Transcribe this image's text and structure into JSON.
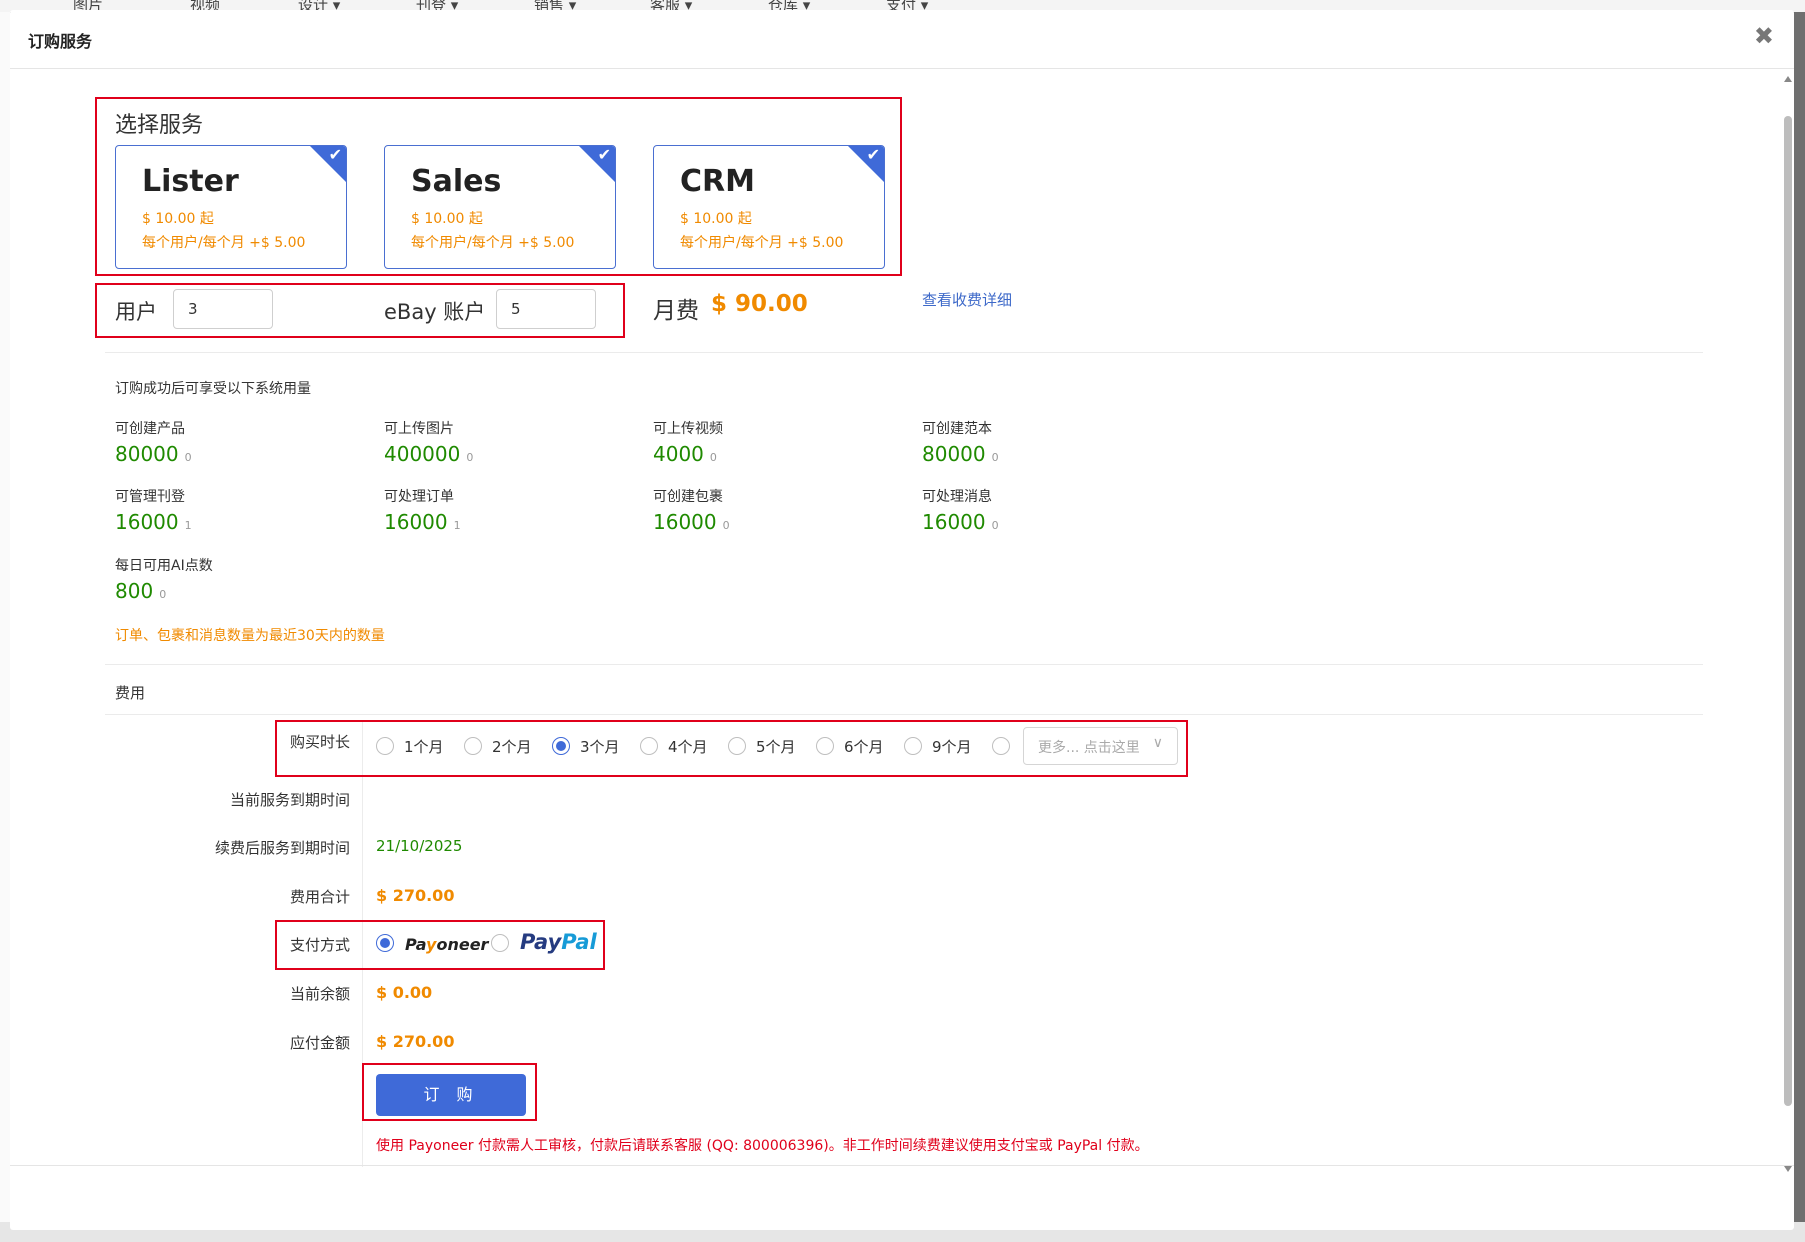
{
  "background": {
    "nav_items": [
      "图片",
      "视频",
      "设计 ▾",
      "刊登 ▾",
      "销售 ▾",
      "客服 ▾",
      "仓库 ▾",
      "支付 ▾"
    ]
  },
  "modal": {
    "title": "订购服务",
    "close_icon": "close-icon"
  },
  "services": {
    "heading": "选择服务",
    "items": [
      {
        "name": "Lister",
        "price": "$ 10.00 起",
        "per_user": "每个用户/每个月 +$ 5.00",
        "selected": true
      },
      {
        "name": "Sales",
        "price": "$ 10.00 起",
        "per_user": "每个用户/每个月 +$ 5.00",
        "selected": true
      },
      {
        "name": "CRM",
        "price": "$ 10.00 起",
        "per_user": "每个用户/每个月 +$ 5.00",
        "selected": true
      }
    ]
  },
  "users": {
    "label": "用户",
    "value": "3"
  },
  "ebay_accounts": {
    "label": "eBay 账户",
    "value": "5"
  },
  "monthly_fee": {
    "label": "月费",
    "amount": "$ 90.00",
    "detail_link": "查看收费详细"
  },
  "quota": {
    "intro": "订购成功后可享受以下系统用量",
    "items": [
      {
        "label": "可创建产品",
        "value": "80000",
        "used": "0"
      },
      {
        "label": "可上传图片",
        "value": "400000",
        "used": "0"
      },
      {
        "label": "可上传视频",
        "value": "4000",
        "used": "0"
      },
      {
        "label": "可创建范本",
        "value": "80000",
        "used": "0"
      },
      {
        "label": "可管理刊登",
        "value": "16000",
        "used": "1"
      },
      {
        "label": "可处理订单",
        "value": "16000",
        "used": "1"
      },
      {
        "label": "可创建包裹",
        "value": "16000",
        "used": "0"
      },
      {
        "label": "可处理消息",
        "value": "16000",
        "used": "0"
      },
      {
        "label": "每日可用AI点数",
        "value": "800",
        "used": "0"
      }
    ],
    "note": "订单、包裹和消息数量为最近30天内的数量"
  },
  "cost": {
    "section_title": "费用",
    "duration_label": "购买时长",
    "durations": [
      "1个月",
      "2个月",
      "3个月",
      "4个月",
      "5个月",
      "6个月",
      "9个月"
    ],
    "selected_duration": "3个月",
    "more_placeholder": "更多... 点击这里",
    "current_expiry_label": "当前服务到期时间",
    "current_expiry_value": "",
    "renewed_expiry_label": "续费后服务到期时间",
    "renewed_expiry_value": "21/10/2025",
    "total_label": "费用合计",
    "total_value": "$ 270.00",
    "payment_label": "支付方式",
    "payment_methods": [
      "Payoneer",
      "PayPal"
    ],
    "selected_payment": "Payoneer",
    "balance_label": "当前余额",
    "balance_value": "$ 0.00",
    "payable_label": "应付金额",
    "payable_value": "$ 270.00",
    "buy_button": "订 购",
    "warning": "使用 Payoneer 付款需人工审核，付款后请联系客服 (QQ: 800006396)。非工作时间续费建议使用支付宝或 PayPal 付款。"
  },
  "colors": {
    "accent": "#3f6ad8",
    "price_orange": "#f08a00",
    "quota_green": "#1f8a00",
    "highlight_red": "#e0001b"
  }
}
